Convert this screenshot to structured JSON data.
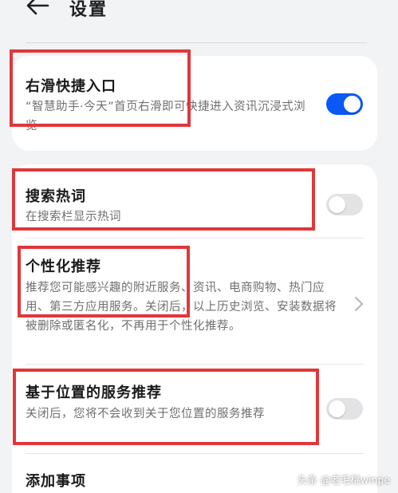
{
  "header": {
    "title": "设置"
  },
  "settings": [
    {
      "title": "右滑快捷入口",
      "desc": "“智慧助手·今天”首页右滑即可快捷进入资讯沉浸式浏览",
      "toggle": "on"
    },
    {
      "title": "搜索热词",
      "desc": "在搜索栏显示热词",
      "toggle": "off"
    },
    {
      "title": "个性化推荐",
      "desc": "推荐您可能感兴趣的附近服务、资讯、电商购物、热门应用、第三方应用服务。关闭后，以上历史浏览、安装数据将被删除或匿名化，不再用于个性化推荐。",
      "control": "chevron"
    },
    {
      "title": "基于位置的服务推荐",
      "desc": "关闭后，您将不会收到关于您位置的服务推荐",
      "toggle": "off"
    },
    {
      "title": "添加事项"
    }
  ],
  "watermark": "头条 @老毛桃winpe",
  "colors": {
    "accent": "#0a59f7",
    "highlight": "#e0373a",
    "background": "#f1f3f5"
  }
}
